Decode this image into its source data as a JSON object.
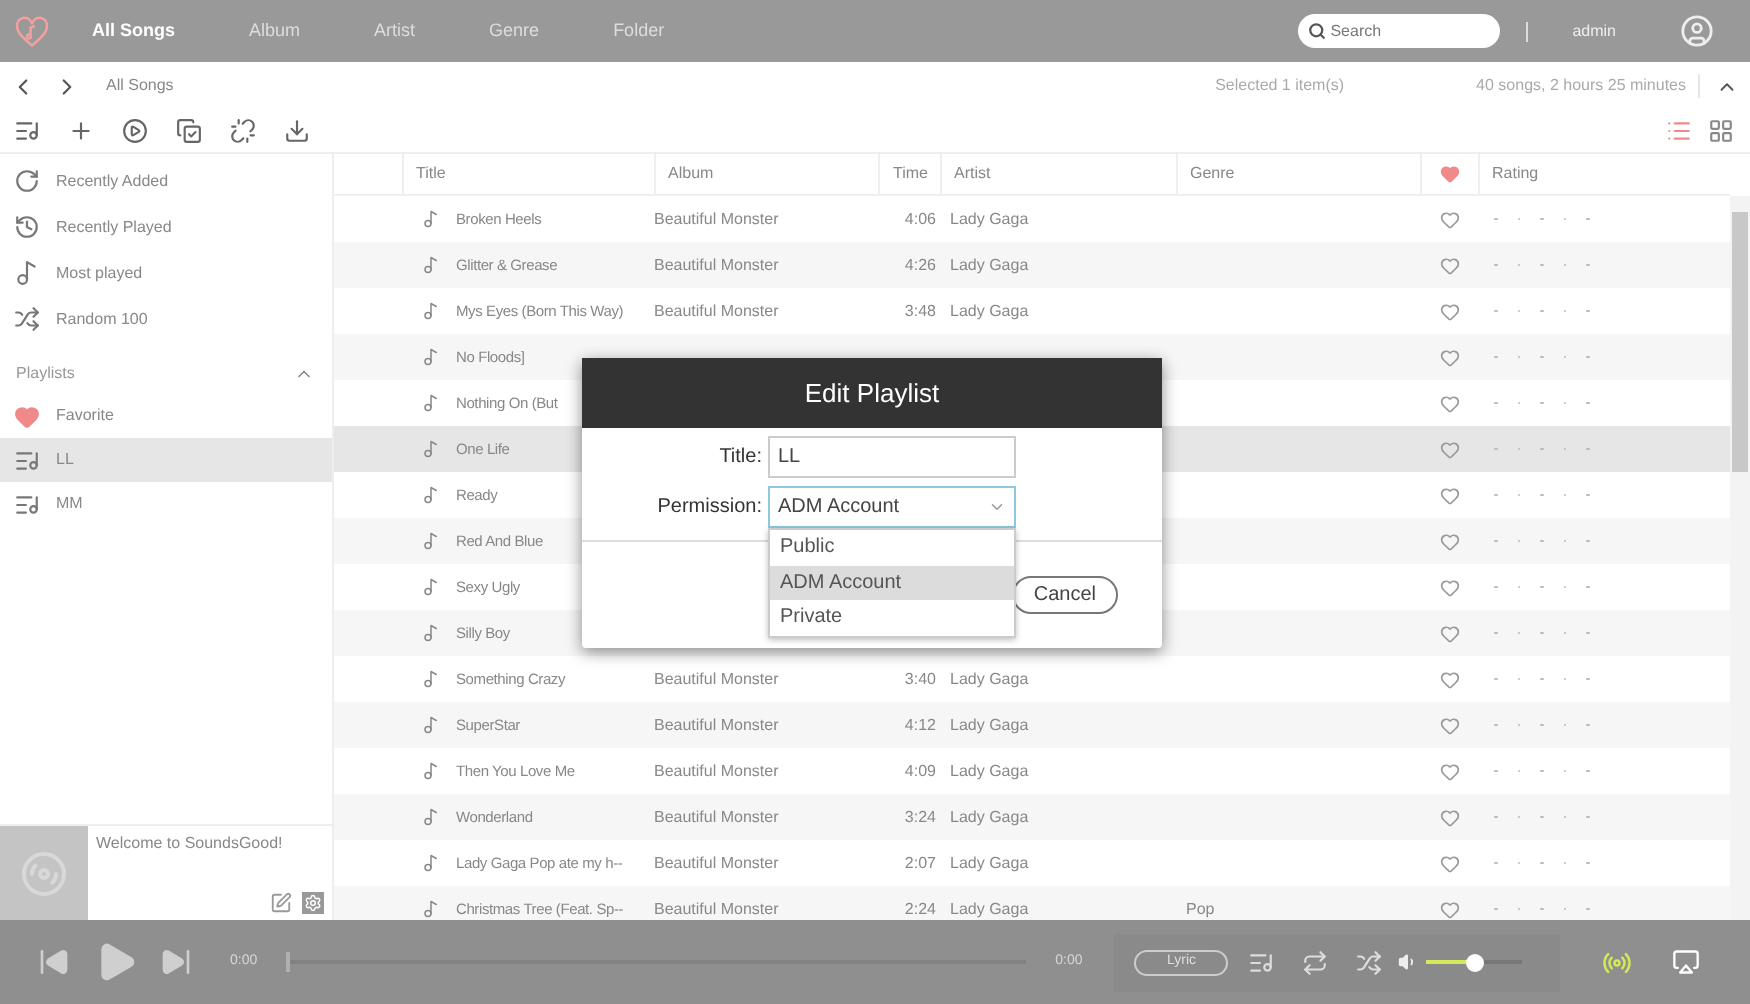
{
  "nav": {
    "tabs": [
      {
        "label": "All Songs",
        "selected": true
      },
      {
        "label": "Album",
        "selected": false
      },
      {
        "label": "Artist",
        "selected": false
      },
      {
        "label": "Genre",
        "selected": false
      },
      {
        "label": "Folder",
        "selected": false
      }
    ]
  },
  "search": {
    "placeholder": "Search"
  },
  "user": "admin",
  "breadcrumb": "All Songs",
  "selection": "Selected 1 item(s)",
  "summary": "40 songs, 2 hours 25 minutes",
  "view_modes": [
    {
      "kind": "list",
      "selected": true
    },
    {
      "kind": "grid",
      "selected": false
    }
  ],
  "sidebar": {
    "library": [
      {
        "kind": "recent-added",
        "label": "Recently Added"
      },
      {
        "kind": "recent-played",
        "label": "Recently Played"
      },
      {
        "kind": "most-played",
        "label": "Most played"
      },
      {
        "kind": "random",
        "label": "Random 100"
      }
    ],
    "playlists_header": "Playlists",
    "playlists_expanded": true,
    "playlists": [
      {
        "kind": "favorite",
        "label": "Favorite",
        "selected": false
      },
      {
        "kind": "playlist",
        "label": "LL",
        "selected": true
      },
      {
        "kind": "playlist",
        "label": "MM",
        "selected": false
      }
    ]
  },
  "now_playing": {
    "text": "Welcome to SoundsGood!"
  },
  "table": {
    "columns": [
      "Title",
      "Album",
      "Time",
      "Artist",
      "Genre",
      "Rating"
    ],
    "rows": [
      {
        "title": "Broken Heels",
        "album": "Beautiful Monster",
        "time": "4:06",
        "artist": "Lady Gaga",
        "liked": false,
        "stars": 0,
        "selected": false
      },
      {
        "title": "Glitter & Grease",
        "album": "Beautiful Monster",
        "time": "4:26",
        "artist": "Lady Gaga",
        "liked": false,
        "stars": 0,
        "selected": false
      },
      {
        "title": "Mys Eyes (Born This Way)",
        "album": "Beautiful Monster",
        "time": "3:48",
        "artist": "Lady Gaga",
        "liked": false,
        "stars": 0,
        "selected": false
      },
      {
        "title": "No Floods]",
        "liked": false,
        "stars": 0,
        "selected": false
      },
      {
        "title": "Nothing On (But",
        "liked": false,
        "stars": 0,
        "selected": false
      },
      {
        "title": "One Life",
        "liked": false,
        "stars": 0,
        "selected": true
      },
      {
        "title": "Ready",
        "liked": false,
        "stars": 0,
        "selected": false
      },
      {
        "title": "Red And Blue",
        "liked": false,
        "stars": 0,
        "selected": false
      },
      {
        "title": "Sexy Ugly",
        "liked": false,
        "stars": 0,
        "selected": false
      },
      {
        "title": "Silly Boy",
        "liked": false,
        "stars": 0,
        "selected": false
      },
      {
        "title": "Something Crazy",
        "album": "Beautiful Monster",
        "time": "3:40",
        "artist": "Lady Gaga",
        "liked": false,
        "stars": 0,
        "selected": false
      },
      {
        "title": "SuperStar",
        "album": "Beautiful Monster",
        "time": "4:12",
        "artist": "Lady Gaga",
        "liked": false,
        "stars": 0,
        "selected": false
      },
      {
        "title": "Then You Love Me",
        "album": "Beautiful Monster",
        "time": "4:09",
        "artist": "Lady Gaga",
        "liked": false,
        "stars": 0,
        "selected": false
      },
      {
        "title": "Wonderland",
        "album": "Beautiful Monster",
        "time": "3:24",
        "artist": "Lady Gaga",
        "liked": false,
        "stars": 0,
        "selected": false
      },
      {
        "title": "Lady Gaga Pop ate my h--",
        "album": "Beautiful Monster",
        "time": "2:07",
        "artist": "Lady Gaga",
        "liked": false,
        "stars": 0,
        "selected": false
      },
      {
        "title": "Christmas Tree (Feat. Sp--",
        "album": "Beautiful Monster",
        "time": "2:24",
        "artist": "Lady Gaga",
        "genre": "Pop",
        "liked": false,
        "stars": 0,
        "selected": false
      }
    ]
  },
  "dialog": {
    "title": "Edit Playlist",
    "fields": [
      {
        "kind": "text",
        "label": "Title:",
        "value": "LL"
      },
      {
        "kind": "select",
        "label": "Permission:",
        "value": "ADM Account",
        "expanded": true
      }
    ],
    "options": [
      {
        "label": "Public",
        "selected": false
      },
      {
        "label": "ADM Account",
        "selected": true
      },
      {
        "label": "Private",
        "selected": false
      }
    ],
    "buttons": [
      "Cancel"
    ]
  },
  "player": {
    "elapsed": "0:00",
    "remaining": "0:00",
    "progress": {
      "level": 0
    },
    "lyric": "Lyric",
    "volume": {
      "level": 0.5
    },
    "broadcast_on": true
  }
}
